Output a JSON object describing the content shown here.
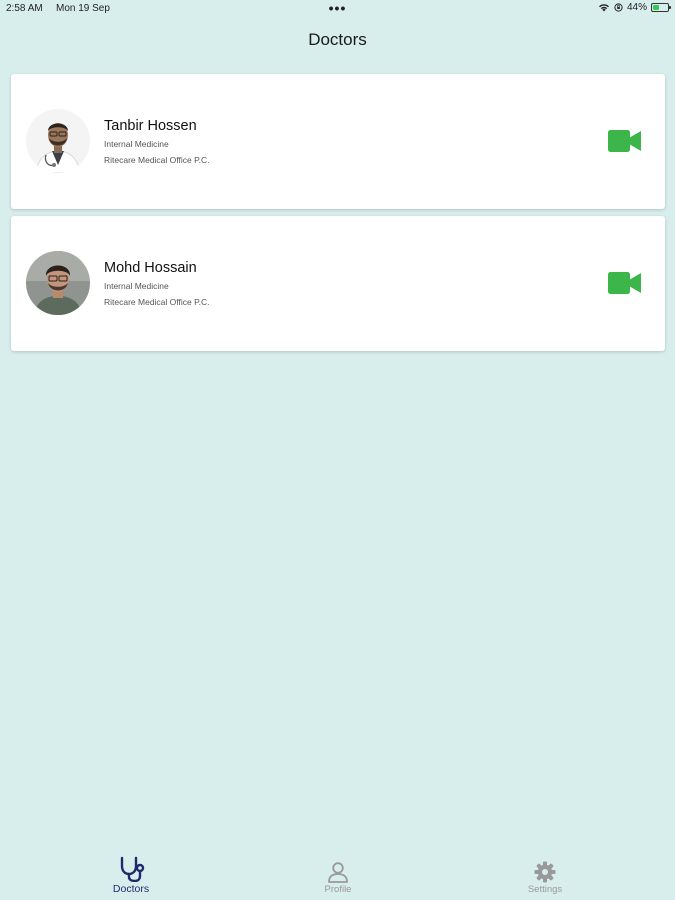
{
  "status_bar": {
    "time": "2:58 AM",
    "date": "Mon 19 Sep",
    "battery_percent": "44%",
    "battery_level": 0.44
  },
  "header": {
    "title": "Doctors"
  },
  "doctors": [
    {
      "name": "Tanbir Hossen",
      "specialty": "Internal Medicine",
      "office": "Ritecare Medical Office P.C."
    },
    {
      "name": "Mohd Hossain",
      "specialty": "Internal Medicine",
      "office": "Ritecare Medical Office P.C."
    }
  ],
  "tabs": [
    {
      "label": "Doctors",
      "icon": "stethoscope-icon",
      "active": true
    },
    {
      "label": "Profile",
      "icon": "person-icon",
      "active": false
    },
    {
      "label": "Settings",
      "icon": "gear-icon",
      "active": false
    }
  ],
  "colors": {
    "background": "#d8eeed",
    "video_green": "#3cb54a",
    "active_tab": "#1f2a6b",
    "inactive_tab": "#999999"
  }
}
